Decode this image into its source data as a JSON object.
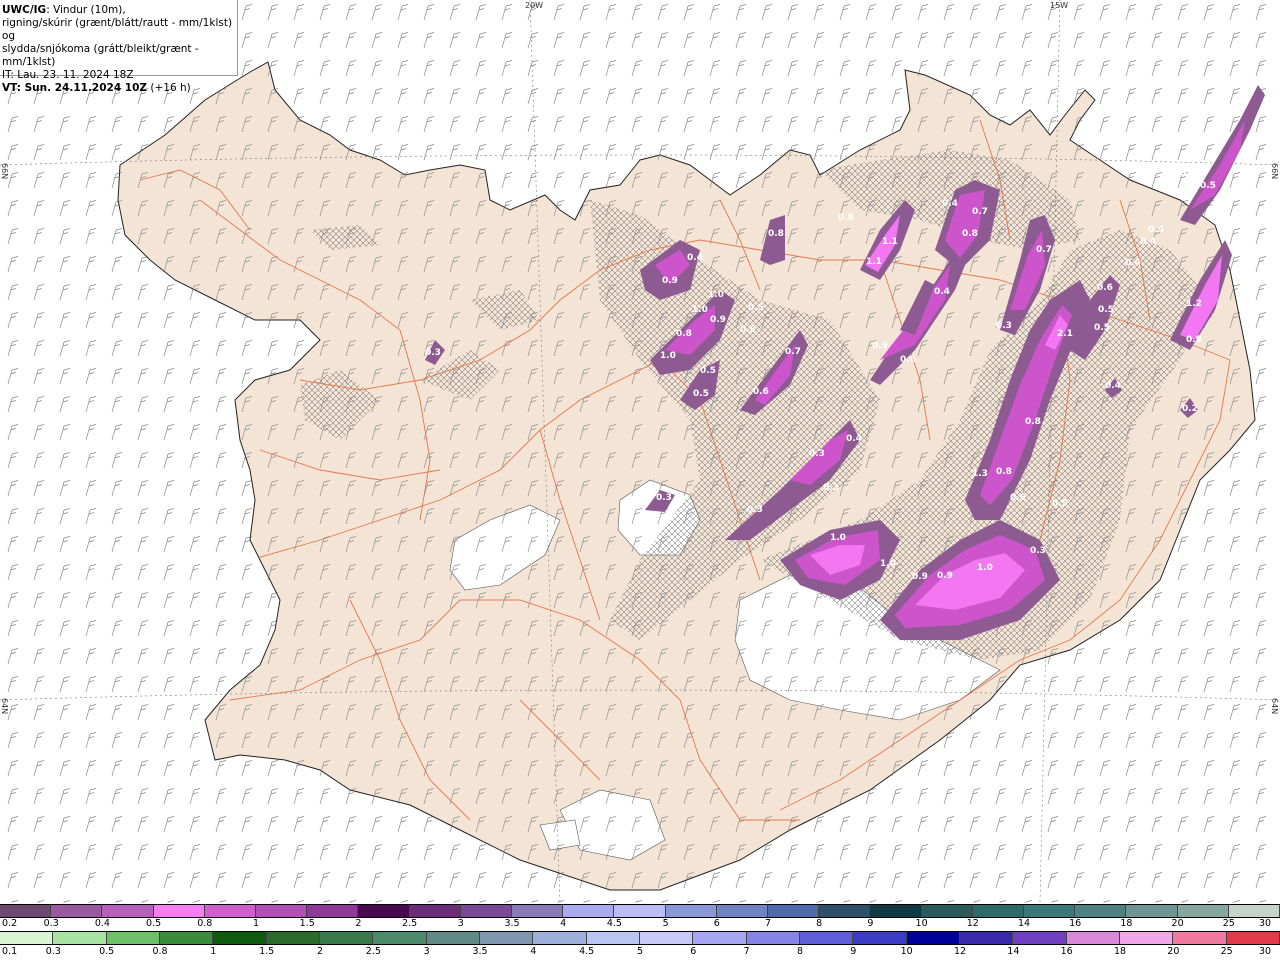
{
  "header": {
    "model": "UWC/IG",
    "desc1": ": Vindur (10m),",
    "desc2": "rigning/skúrir (grænt/blátt/rautt - mm/1klst) og",
    "desc3": "slydda/snjókoma (grátt/bleikt/grænt - mm/1klst)",
    "it": "IT: Lau. 23. 11. 2024 18Z",
    "vt_bold": "VT: Sun. 24.11.2024 10Z",
    "vt_rest": " (+16 h)"
  },
  "graticule": {
    "lon_top": [
      "20W",
      "15W"
    ],
    "lat_left": [
      "66N",
      "64N"
    ],
    "lat_right": [
      "66N",
      "64N"
    ]
  },
  "precip_values": [
    "0.4",
    "0.9",
    "1.0",
    "0.8",
    "1.0",
    "0.9",
    "0.8",
    "1.0",
    "0.5",
    "0.5",
    "0.8",
    "0.5",
    "0.7",
    "0.6",
    "0.8",
    "1.1",
    "1.1",
    "0.4",
    "0.7",
    "0.8",
    "0.4",
    "0.9",
    "0.6",
    "0.7",
    "0.3",
    "0.6",
    "0.5",
    "2.1",
    "0.5",
    "0.3",
    "0.5",
    "0.4",
    "0.4",
    "1.2",
    "0.9",
    "0.3",
    "0.4",
    "0.3",
    "0.3",
    "0.3",
    "1.0",
    "1.0",
    "0.9",
    "0.9",
    "1.0",
    "0.6",
    "0.8",
    "1.3",
    "0.8",
    "0.5",
    "0.3",
    "0.3",
    "0.4",
    "0.4",
    "0.2"
  ],
  "colors": {
    "land": "#f3e4d6",
    "sea": "#ffffff",
    "roads": "#e96a3a",
    "snow_light": "#8e5a92",
    "snow_mid": "#cc55cc",
    "snow_heavy": "#f377f3"
  },
  "legend_snow": {
    "labels": [
      "0.2",
      "0.3",
      "0.4",
      "0.5",
      "0.8",
      "1",
      "1.5",
      "2",
      "2.5",
      "3",
      "3.5",
      "4",
      "4.5",
      "5",
      "6",
      "7",
      "8",
      "9",
      "10",
      "12",
      "14",
      "16",
      "18",
      "20",
      "25",
      "30"
    ],
    "colors": [
      "#6e4a72",
      "#9a5aa0",
      "#b65fbb",
      "#f57ef5",
      "#cf5fcf",
      "#b34fb8",
      "#8f3a98",
      "#4a0a4f",
      "#6d2c78",
      "#7b4a95",
      "#8a7ab8",
      "#aaaaee",
      "#bdbdf5",
      "#8a98d8",
      "#6f84c2",
      "#4f6aa8",
      "#2e506b",
      "#0f3a44",
      "#2a5a5a",
      "#2f6a66",
      "#3d7777",
      "#4f8282",
      "#6f9494",
      "#87a6a0",
      "#c4d4cc"
    ]
  },
  "legend_rain": {
    "labels": [
      "0.1",
      "0.3",
      "0.5",
      "0.8",
      "1",
      "1.5",
      "2",
      "2.5",
      "3",
      "3.5",
      "4",
      "4.5",
      "5",
      "6",
      "7",
      "8",
      "9",
      "10",
      "12",
      "14",
      "16",
      "18",
      "20",
      "25",
      "30"
    ],
    "colors": [
      "#d9f5d2",
      "#a9e3a2",
      "#6fbf6a",
      "#3c8a3c",
      "#0f5a0f",
      "#2a6a2a",
      "#3a7a4a",
      "#4d8a6a",
      "#608a88",
      "#7f98b0",
      "#9db0dc",
      "#b9c6f2",
      "#c9c9f8",
      "#a6a6f2",
      "#8585e8",
      "#5e5ed8",
      "#3b3bc8",
      "#00009a",
      "#3a2aaa",
      "#7040c0",
      "#d88ad8",
      "#f0a8e8",
      "#f07aa0",
      "#e23a4a"
    ]
  }
}
